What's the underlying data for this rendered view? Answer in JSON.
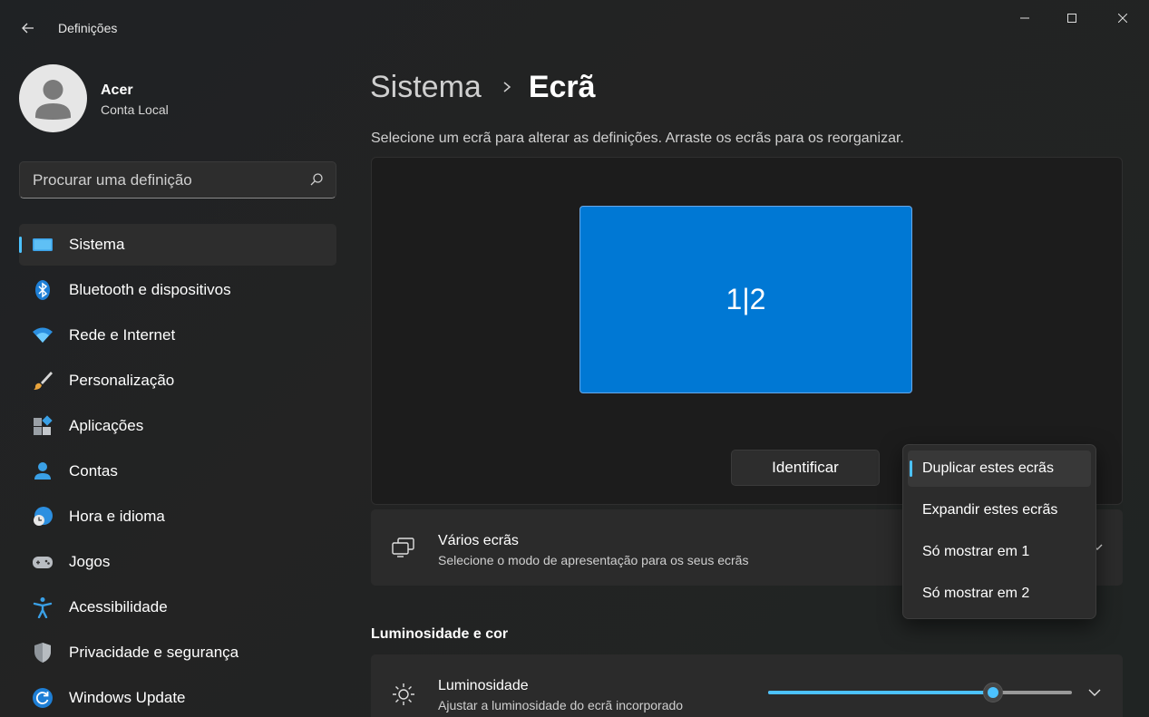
{
  "window": {
    "title": "Definições"
  },
  "profile": {
    "name": "Acer",
    "account_type": "Conta Local"
  },
  "search": {
    "placeholder": "Procurar uma definição"
  },
  "sidebar": {
    "items": [
      {
        "label": "Sistema",
        "icon": "system-icon",
        "selected": true
      },
      {
        "label": "Bluetooth e dispositivos",
        "icon": "bluetooth-icon"
      },
      {
        "label": "Rede e Internet",
        "icon": "wifi-icon"
      },
      {
        "label": "Personalização",
        "icon": "brush-icon"
      },
      {
        "label": "Aplicações",
        "icon": "apps-icon"
      },
      {
        "label": "Contas",
        "icon": "person-icon"
      },
      {
        "label": "Hora e idioma",
        "icon": "globe-clock-icon"
      },
      {
        "label": "Jogos",
        "icon": "gamepad-icon"
      },
      {
        "label": "Acessibilidade",
        "icon": "accessibility-icon"
      },
      {
        "label": "Privacidade e segurança",
        "icon": "shield-icon"
      },
      {
        "label": "Windows Update",
        "icon": "update-icon"
      }
    ]
  },
  "breadcrumb": {
    "parent": "Sistema",
    "current": "Ecrã"
  },
  "display": {
    "description": "Selecione um ecrã para alterar as definições. Arraste os ecrãs para os reorganizar.",
    "monitor_label": "1|2",
    "identify_label": "Identificar"
  },
  "multiple_displays": {
    "title": "Vários ecrãs",
    "subtitle": "Selecione o modo de apresentação para os seus ecrãs"
  },
  "projection_menu": {
    "options": [
      {
        "label": "Duplicar estes ecrãs",
        "selected": true
      },
      {
        "label": "Expandir estes ecrãs"
      },
      {
        "label": "Só mostrar em 1"
      },
      {
        "label": "Só mostrar em 2"
      }
    ]
  },
  "brightness_section": {
    "heading": "Luminosidade e cor",
    "title": "Luminosidade",
    "subtitle": "Ajustar a luminosidade do ecrã incorporado",
    "value_fraction": 0.74
  },
  "colors": {
    "accent": "#4cc2ff",
    "monitor": "#0078d4"
  }
}
